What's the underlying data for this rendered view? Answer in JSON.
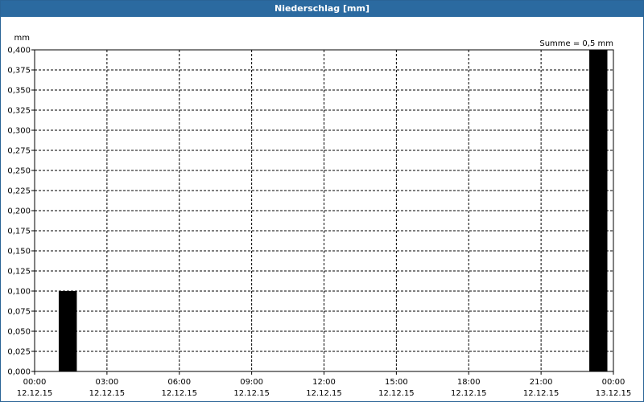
{
  "window": {
    "title": "Niederschlag [mm]"
  },
  "colors": {
    "titlebar": "#2b6aa0",
    "bar": "#000000",
    "grid": "#000000"
  },
  "chart_data": {
    "type": "bar",
    "title": "Niederschlag [mm]",
    "ylabel": "mm",
    "xlabel": "",
    "annotation": "Summe = 0,5 mm",
    "ylim": [
      0,
      0.4
    ],
    "grid": true,
    "y_ticks": [
      "0,000",
      "0,025",
      "0,050",
      "0,075",
      "0,100",
      "0,125",
      "0,150",
      "0,175",
      "0,200",
      "0,225",
      "0,250",
      "0,275",
      "0,300",
      "0,325",
      "0,350",
      "0,375",
      "0,400"
    ],
    "x_ticks": [
      {
        "time": "00:00",
        "date": "12.12.15"
      },
      {
        "time": "03:00",
        "date": "12.12.15"
      },
      {
        "time": "06:00",
        "date": "12.12.15"
      },
      {
        "time": "09:00",
        "date": "12.12.15"
      },
      {
        "time": "12:00",
        "date": "12.12.15"
      },
      {
        "time": "15:00",
        "date": "12.12.15"
      },
      {
        "time": "18:00",
        "date": "12.12.15"
      },
      {
        "time": "21:00",
        "date": "12.12.15"
      },
      {
        "time": "00:00",
        "date": "13.12.15"
      }
    ],
    "x_range_hours": [
      0,
      24
    ],
    "bars": [
      {
        "start_hour": 1.0,
        "end_hour": 1.75,
        "value": 0.1
      },
      {
        "start_hour": 23.0,
        "end_hour": 23.75,
        "value": 0.4
      }
    ]
  }
}
